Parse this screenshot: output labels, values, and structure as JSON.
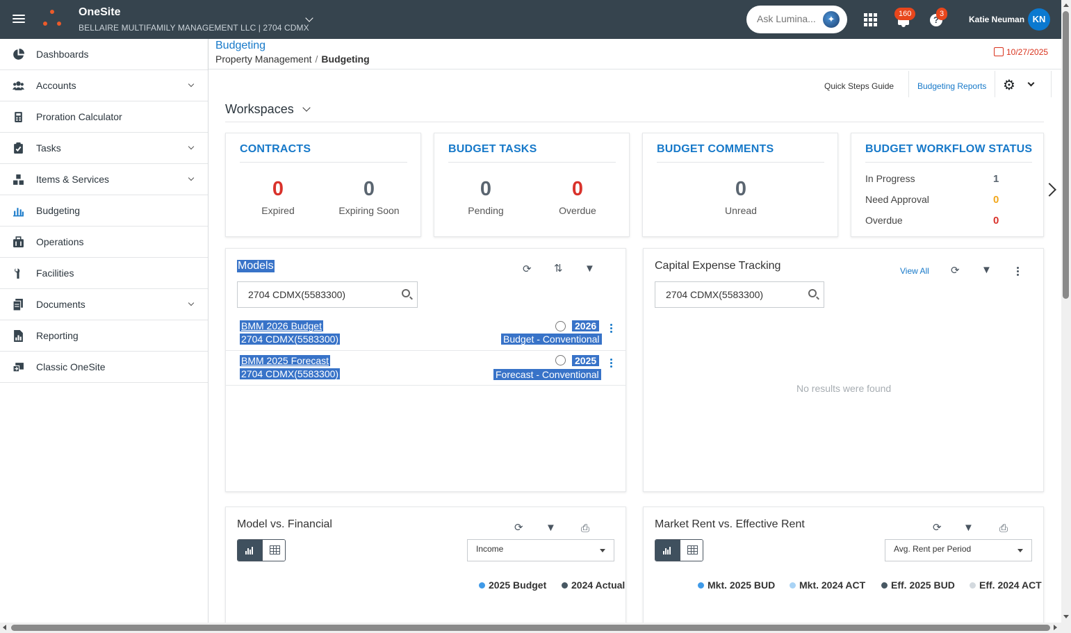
{
  "header": {
    "app_title": "OneSite",
    "subtitle": "BELLAIRE MULTIFAMILY MANAGEMENT LLC | 2704 CDMX",
    "ask_placeholder": "Ask Lumina...",
    "notification_count": "160",
    "help_count": "3",
    "user_name": "Katie Neuman",
    "user_initials": "KN"
  },
  "sidebar": {
    "items": [
      {
        "label": "Dashboards",
        "icon": "pie-chart-icon",
        "expandable": false
      },
      {
        "label": "Accounts",
        "icon": "users-icon",
        "expandable": true
      },
      {
        "label": "Proration Calculator",
        "icon": "calculator-icon",
        "expandable": false
      },
      {
        "label": "Tasks",
        "icon": "clipboard-check-icon",
        "expandable": true
      },
      {
        "label": "Items & Services",
        "icon": "boxes-icon",
        "expandable": true
      },
      {
        "label": "Budgeting",
        "icon": "bar-chart-icon",
        "expandable": false,
        "active": true
      },
      {
        "label": "Operations",
        "icon": "briefcase-icon",
        "expandable": false
      },
      {
        "label": "Facilities",
        "icon": "wrench-icon",
        "expandable": false
      },
      {
        "label": "Documents",
        "icon": "documents-icon",
        "expandable": true
      },
      {
        "label": "Reporting",
        "icon": "report-icon",
        "expandable": false
      },
      {
        "label": "Classic OneSite",
        "icon": "classic-icon",
        "expandable": false
      }
    ]
  },
  "page": {
    "title": "Budgeting",
    "breadcrumb_parent": "Property Management",
    "breadcrumb_sep": "/",
    "breadcrumb_current": "Budgeting",
    "date": "10/27/2025"
  },
  "toolbar": {
    "quick_steps": "Quick Steps Guide",
    "budget_reports": "Budgeting Reports"
  },
  "workspaces_label": "Workspaces",
  "summary": {
    "contracts": {
      "title": "CONTRACTS",
      "expired": "0",
      "expired_label": "Expired",
      "expiring": "0",
      "expiring_label": "Expiring Soon"
    },
    "tasks": {
      "title": "BUDGET TASKS",
      "pending": "0",
      "pending_label": "Pending",
      "overdue": "0",
      "overdue_label": "Overdue"
    },
    "comments": {
      "title": "BUDGET COMMENTS",
      "unread": "0",
      "unread_label": "Unread"
    },
    "workflow": {
      "title": "BUDGET WORKFLOW STATUS",
      "rows": [
        {
          "label": "In Progress",
          "value": "1"
        },
        {
          "label": "Need Approval",
          "value": "0"
        },
        {
          "label": "Overdue",
          "value": "0"
        }
      ]
    }
  },
  "models": {
    "title": "Models",
    "search_value": "2704 CDMX(5583300)",
    "rows": [
      {
        "name": "BMM 2026 Budget",
        "property": "2704 CDMX(5583300)",
        "year": "2026",
        "type": "Budget - Conventional"
      },
      {
        "name": "BMM 2025 Forecast",
        "property": "2704 CDMX(5583300)",
        "year": "2025",
        "type": "Forecast - Conventional"
      }
    ]
  },
  "capex": {
    "title": "Capital Expense Tracking",
    "view_all": "View All",
    "search_value": "2704 CDMX(5583300)",
    "empty": "No results were found"
  },
  "model_vs_financial": {
    "title": "Model vs. Financial",
    "select_value": "Income",
    "legend": [
      {
        "name": "2025 Budget",
        "color": "#3f9ae8"
      },
      {
        "name": "2024 Actual",
        "color": "#485863"
      }
    ]
  },
  "market_rent": {
    "title": "Market Rent vs. Effective Rent",
    "select_value": "Avg. Rent per Period",
    "legend": [
      {
        "name": "Mkt. 2025 BUD",
        "color": "#3f9ae8"
      },
      {
        "name": "Mkt. 2024 ACT",
        "color": "#a9d3f5"
      },
      {
        "name": "Eff. 2025 BUD",
        "color": "#485863"
      },
      {
        "name": "Eff. 2024 ACT",
        "color": "#d3d9de"
      }
    ]
  }
}
